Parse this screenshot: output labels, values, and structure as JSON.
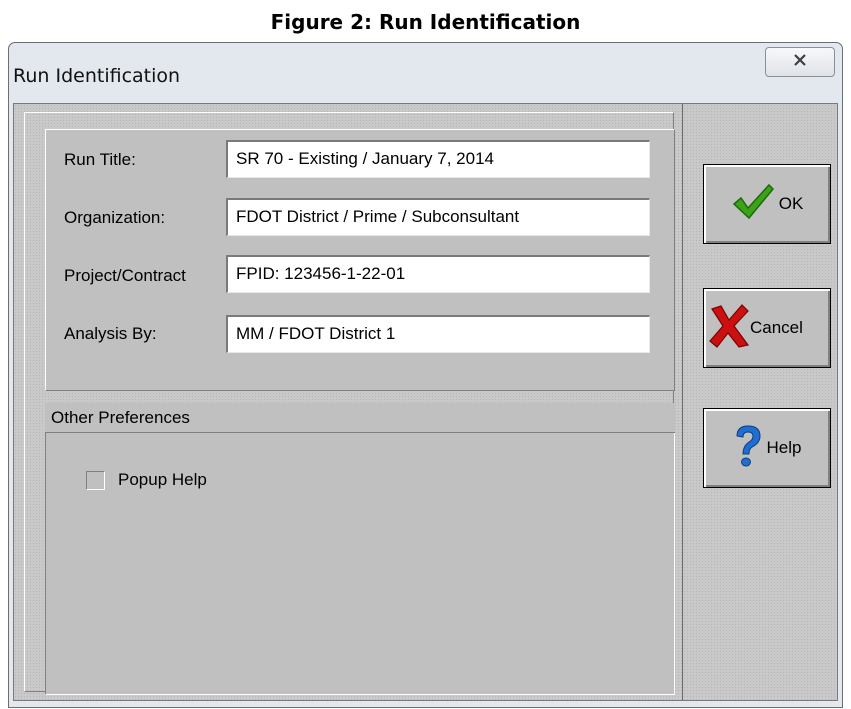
{
  "caption": "Figure 2:  Run Identification",
  "window": {
    "title": "Run Identification",
    "close_icon": "close-icon"
  },
  "fields": [
    {
      "label": "Run Title:",
      "value": "SR 70 - Existing / January 7, 2014"
    },
    {
      "label": "Organization:",
      "value": "FDOT District / Prime / Subconsultant"
    },
    {
      "label": "Project/Contract",
      "value": "FPID: 123456-1-22-01"
    },
    {
      "label": "Analysis By:",
      "value": "MM / FDOT District 1"
    }
  ],
  "preferences": {
    "header": "Other Preferences",
    "popup_help": {
      "label": "Popup Help",
      "checked": false
    }
  },
  "buttons": {
    "ok": {
      "label": "OK",
      "icon": "checkmark-icon",
      "color": "#3aa318"
    },
    "cancel": {
      "label": "Cancel",
      "icon": "x-icon",
      "color": "#cc1010"
    },
    "help": {
      "label": "Help",
      "icon": "question-icon",
      "color": "#1e6fd0"
    }
  }
}
